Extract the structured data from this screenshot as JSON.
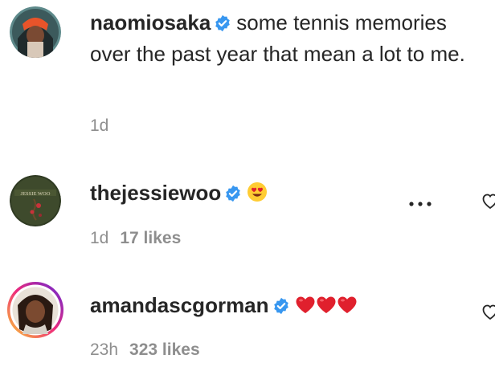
{
  "comments": [
    {
      "username": "naomiosaka",
      "text": "some tennis memories over the past year that mean a lot to me.",
      "time": "1d",
      "likes": ""
    },
    {
      "username": "thejessiewoo",
      "text": "",
      "emoji": "heart-eyes-emoji",
      "time": "1d",
      "likes": "17 likes",
      "avatar_text": "JESSIE WOO"
    },
    {
      "username": "amandascgorman",
      "text": "",
      "emoji": "red-heart-emoji x3",
      "time": "23h",
      "likes": "323 likes"
    }
  ],
  "colors": {
    "verified_blue": "#3897f0",
    "meta_gray": "#8e8e8e",
    "text": "#262626",
    "heart_red": "#e0202d",
    "ring_gradient": [
      "#f9ce34",
      "#ee2a7b",
      "#6228d7"
    ]
  },
  "icons": [
    "verified-badge-icon",
    "more-options-icon",
    "like-heart-icon"
  ]
}
